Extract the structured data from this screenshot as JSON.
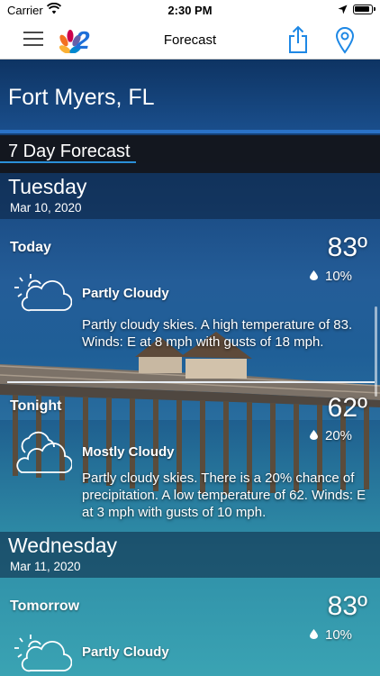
{
  "status_bar": {
    "carrier": "Carrier",
    "time": "2:30 PM"
  },
  "navbar": {
    "title": "Forecast",
    "logo": "NBC 2"
  },
  "location": {
    "city": "Fort Myers, FL"
  },
  "forecast_header": "7 Day Forecast",
  "days": [
    {
      "day": "Tuesday",
      "date": "Mar 10, 2020",
      "periods": [
        {
          "name": "Today",
          "temp": "83º",
          "precip": "10%",
          "icon": "partly-cloudy-icon",
          "condition": "Partly Cloudy",
          "description": "Partly cloudy skies.  A high temperature of 83.  Winds: E at 8 mph with gusts of 18 mph."
        },
        {
          "name": "Tonight",
          "temp": "62º",
          "precip": "20%",
          "icon": "mostly-cloudy-icon",
          "condition": "Mostly Cloudy",
          "description": "Partly cloudy skies. There is a 20% chance of precipitation.  A low temperature of 62.  Winds: E at 3 mph with gusts of 10 mph."
        }
      ]
    },
    {
      "day": "Wednesday",
      "date": "Mar 11, 2020",
      "periods": [
        {
          "name": "Tomorrow",
          "temp": "83º",
          "precip": "10%",
          "icon": "partly-cloudy-icon",
          "condition": "Partly Cloudy"
        }
      ]
    }
  ],
  "colors": {
    "accent": "#2a8fd8",
    "nav_icon": "#1e88e5",
    "header_band": "#0e3463"
  }
}
